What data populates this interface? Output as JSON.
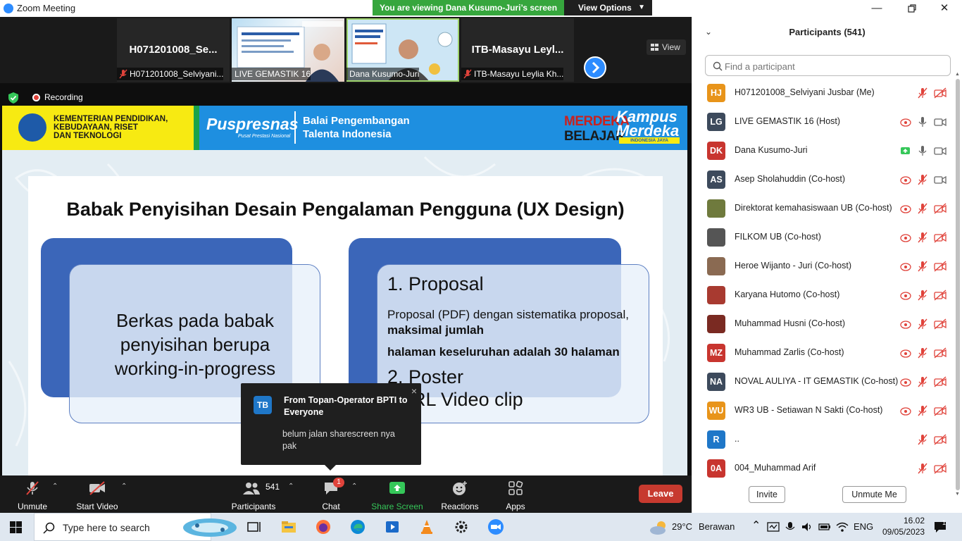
{
  "window": {
    "title": "Zoom Meeting",
    "viewing_banner": "You are viewing Dana Kusumo-Juri’s screen",
    "view_options": "View Options",
    "view_button": "View"
  },
  "thumbnails": [
    {
      "big_name": "H071201008_Se...",
      "caption": "H071201008_Selviyani...",
      "muted": true
    },
    {
      "caption": "LIVE GEMASTIK 16",
      "muted": false
    },
    {
      "caption": "Dana Kusumo-Juri",
      "muted": false
    },
    {
      "big_name": "ITB-Masayu  Leyl...",
      "caption": "ITB-Masayu Leylia Kh...",
      "muted": true
    }
  ],
  "recording": {
    "label": "Recording"
  },
  "slide": {
    "banner": {
      "kementerian": "KEMENTERIAN PENDIDIKAN,\nKEBUDAYAAN, RISET\nDAN TEKNOLOGI",
      "puspresnas": "Puspresnas",
      "puspresnas_sub": "Pusat Prestasi Nasional",
      "balai": "Balai Pengembangan\nTalenta Indonesia",
      "merdeka": "MERDEKA",
      "belajar": "BELAJAR",
      "kampus": "Kampus\nMerdeka",
      "indonesia_jaya": "INDONESIA JAYA"
    },
    "title": "Babak Penyisihan Desain Pengalaman Pengguna (UX Design)",
    "left_text": "Berkas pada babak\npenyisihan berupa\nworking-in-progress",
    "proposal_heading": "1. Proposal",
    "proposal_text": "Proposal (PDF) dengan sistematika proposal,",
    "proposal_bold": "maksimal jumlah",
    "proposal_bold2": "halaman keseluruhan adalah 30 halaman",
    "poster_heading": "2. Poster",
    "url_heading": "RL Video clip"
  },
  "chat_toast": {
    "avatar": "TB",
    "from": "From Topan-Operator BPTI to Everyone",
    "message": "belum jalan sharescreen nya pak",
    "close": "×"
  },
  "toolbar": {
    "unmute": "Unmute",
    "start_video": "Start Video",
    "participants": "Participants",
    "participants_count": "541",
    "chat": "Chat",
    "chat_badge": "1",
    "share_screen": "Share Screen",
    "reactions": "Reactions",
    "apps": "Apps",
    "leave": "Leave"
  },
  "panel": {
    "title": "Participants (541)",
    "search_placeholder": "Find a participant",
    "invite": "Invite",
    "unmute_me": "Unmute Me",
    "participants": [
      {
        "initials": "HJ",
        "color": "#e8941a",
        "name": "H071201008_Selviyani Jusbar (Me)",
        "cloud": false,
        "cloud_green": false,
        "mic": "muted",
        "video": "off"
      },
      {
        "initials": "LG",
        "color": "#3d4a5c",
        "name": "LIVE GEMASTIK 16 (Host)",
        "cloud": true,
        "cloud_green": false,
        "mic": "on",
        "video": "on"
      },
      {
        "initials": "DK",
        "color": "#c8352f",
        "name": "Dana Kusumo-Juri",
        "cloud": true,
        "cloud_green": true,
        "mic": "on",
        "video": "on"
      },
      {
        "initials": "AS",
        "color": "#3d4a5c",
        "name": "Asep Sholahuddin (Co-host)",
        "cloud": true,
        "cloud_green": false,
        "mic": "muted",
        "video": "on"
      },
      {
        "initials": "",
        "color": "#6f7a3d",
        "name": "Direktorat kemahasiswaan UB (Co-host)",
        "cloud": true,
        "cloud_green": false,
        "mic": "muted",
        "video": "off"
      },
      {
        "initials": "",
        "color": "#555555",
        "name": "FILKOM UB (Co-host)",
        "cloud": true,
        "cloud_green": false,
        "mic": "muted",
        "video": "off"
      },
      {
        "initials": "",
        "color": "#8a6a52",
        "name": "Heroe Wijanto - Juri (Co-host)",
        "cloud": true,
        "cloud_green": false,
        "mic": "muted",
        "video": "off"
      },
      {
        "initials": "",
        "color": "#a83a30",
        "name": "Karyana Hutomo (Co-host)",
        "cloud": true,
        "cloud_green": false,
        "mic": "muted",
        "video": "off"
      },
      {
        "initials": "",
        "color": "#7a2a22",
        "name": "Muhammad Husni (Co-host)",
        "cloud": true,
        "cloud_green": false,
        "mic": "muted",
        "video": "off"
      },
      {
        "initials": "MZ",
        "color": "#c8352f",
        "name": "Muhammad Zarlis (Co-host)",
        "cloud": true,
        "cloud_green": false,
        "mic": "muted",
        "video": "off"
      },
      {
        "initials": "NA",
        "color": "#3d4a5c",
        "name": "NOVAL AULIYA - IT GEMASTIK (Co-host)",
        "cloud": true,
        "cloud_green": false,
        "mic": "muted",
        "video": "off"
      },
      {
        "initials": "WU",
        "color": "#e8941a",
        "name": "WR3 UB - Setiawan N Sakti (Co-host)",
        "cloud": true,
        "cloud_green": false,
        "mic": "muted",
        "video": "off"
      },
      {
        "initials": "R",
        "color": "#1f77c8",
        "name": "..",
        "cloud": false,
        "cloud_green": false,
        "mic": "muted",
        "video": "off"
      },
      {
        "initials": "0A",
        "color": "#c8352f",
        "name": "004_Muhammad Arif",
        "cloud": false,
        "cloud_green": false,
        "mic": "muted",
        "video": "off"
      }
    ]
  },
  "taskbar": {
    "search_placeholder": "Type here to search",
    "weather_temp": "29°C",
    "weather_desc": "Berawan",
    "lang": "ENG",
    "time": "16.02",
    "date": "09/05/2023",
    "notif_count": "1"
  },
  "colors": {
    "zoom_blue": "#2D8CFF",
    "leave_red": "#c73a2f",
    "share_green": "#35c759",
    "muted_red": "#e0433b"
  }
}
